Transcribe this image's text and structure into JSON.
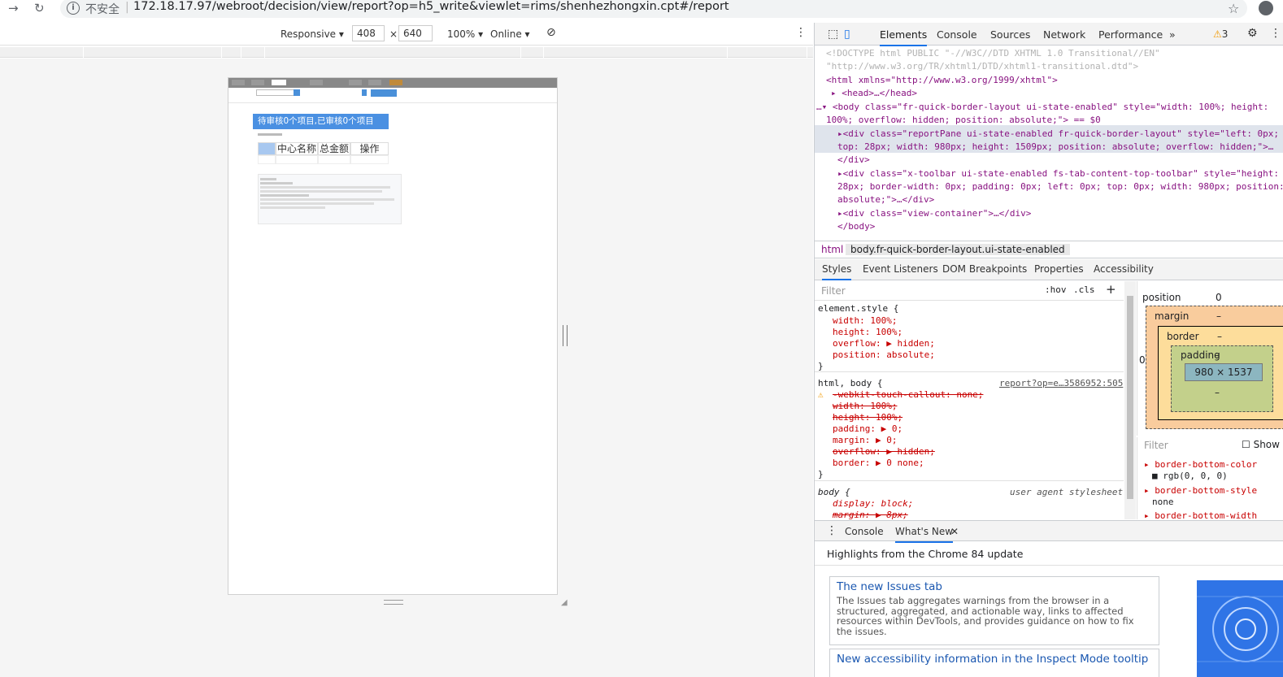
{
  "browser": {
    "insecure_label": "不安全",
    "url": "172.18.17.97/webroot/decision/view/report?op=h5_write&viewlet=rims/shenhezhongxin.cpt#/report"
  },
  "device_toolbar": {
    "device": "Responsive",
    "width": "408",
    "times": "×",
    "height": "640",
    "zoom": "100%",
    "network": "Online"
  },
  "report": {
    "banner": "待审核0个项目,已审核0个项目",
    "columns": [
      "中心名称",
      "总金额",
      "操作"
    ]
  },
  "devtools": {
    "tabs": [
      "Elements",
      "Console",
      "Sources",
      "Network",
      "Performance"
    ],
    "warnings": "3",
    "dom": [
      "<!DOCTYPE html PUBLIC \"-//W3C//DTD XHTML 1.0 Transitional//EN\"",
      "\"http://www.w3.org/TR/xhtml1/DTD/xhtml1-transitional.dtd\">",
      "<html xmlns=\"http://www.w3.org/1999/xhtml\">",
      "<head>…</head>",
      "<body class=\"fr-quick-border-layout ui-state-enabled\" style=\"width: 100%; height:",
      "100%; overflow: hidden; position: absolute;\"> == $0",
      "<div class=\"reportPane ui-state-enabled fr-quick-border-layout\" style=\"left: 0px;",
      "top: 28px; width: 980px; height: 1509px; position: absolute; overflow: hidden;\">…",
      "</div>",
      "<div class=\"x-toolbar ui-state-enabled fs-tab-content-top-toolbar\" style=\"height:",
      "28px; border-width: 0px; padding: 0px; left: 0px; top: 0px; width: 980px; position:",
      "absolute;\">…</div>",
      "<div class=\"view-container\">…</div>",
      "</body>"
    ],
    "breadcrumbs": [
      "html",
      "body.fr-quick-border-layout.ui-state-enabled"
    ],
    "style_tabs": [
      "Styles",
      "Event Listeners",
      "DOM Breakpoints",
      "Properties",
      "Accessibility"
    ],
    "filter_placeholder": "Filter",
    "hov": ":hov",
    "cls": ".cls",
    "styles": {
      "element_style": "element.style {",
      "es_props": [
        "width: 100%;",
        "height: 100%;",
        "overflow: ▶ hidden;",
        "position: absolute;"
      ],
      "rule2_sel": "html, body {",
      "rule2_src": "report?op=e…3586952:505",
      "rule2_props": [
        "-webkit-touch-callout: none;",
        "width: 100%;",
        "height: 100%;",
        "padding: ▶ 0;",
        "margin: ▶ 0;",
        "overflow: ▶ hidden;",
        "border: ▶ 0 none;"
      ],
      "rule3_sel": "body {",
      "rule3_src": "user agent stylesheet",
      "rule3_props": [
        "display: block;",
        "margin: ▶ 8px;"
      ]
    },
    "box_model": {
      "position_label": "position",
      "position_value": "0",
      "margin_label": "margin",
      "border_label": "border",
      "padding_label": "padding",
      "content": "980 × 1537",
      "dash": "–",
      "zero": "0"
    },
    "computed": {
      "filter": "Filter",
      "show_all": "Show",
      "items": [
        "border-bottom-color",
        "rgb(0, 0, 0)",
        "border-bottom-style",
        "none",
        "border-bottom-width"
      ]
    },
    "drawer": {
      "tabs": [
        "Console",
        "What's New"
      ],
      "headline": "Highlights from the Chrome 84 update",
      "card1_title": "The new Issues tab",
      "card1_body": "The Issues tab aggregates warnings from the browser in a structured, aggregated, and actionable way, links to affected resources within DevTools, and provides guidance on how to fix the issues.",
      "card2_title": "New accessibility information in the Inspect Mode tooltip"
    }
  }
}
